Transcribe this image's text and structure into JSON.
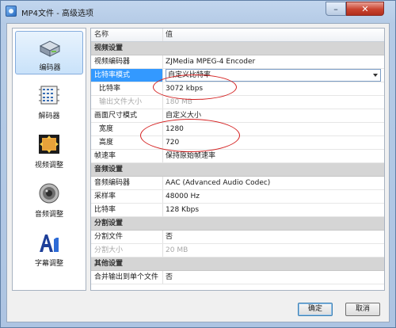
{
  "window": {
    "title": "MP4文件 - 高级选项",
    "minimize_glyph": "–",
    "close_glyph": "✕"
  },
  "sidebar": {
    "items": [
      {
        "label": "编码器",
        "icon": "encoder-icon",
        "active": true
      },
      {
        "label": "解码器",
        "icon": "decoder-icon",
        "active": false
      },
      {
        "label": "视频调整",
        "icon": "video-adjust-icon",
        "active": false
      },
      {
        "label": "音频调整",
        "icon": "audio-adjust-icon",
        "active": false
      },
      {
        "label": "字幕调整",
        "icon": "subtitle-adjust-icon",
        "active": false
      }
    ]
  },
  "grid": {
    "header": {
      "name": "名称",
      "value": "值"
    },
    "categories": {
      "video": "视频设置",
      "audio": "音频设置",
      "split": "分割设置",
      "other": "其他设置"
    },
    "video_rows": {
      "encoder": {
        "name": "视频编码器",
        "value": "ZJMedia MPEG-4 Encoder"
      },
      "bitrate_mode": {
        "name": "比特率模式",
        "value": "自定义比特率"
      },
      "bitrate": {
        "name": "比特率",
        "value": "3072 kbps"
      },
      "output_size": {
        "name": "输出文件大小",
        "value": "180 MB"
      },
      "frame_mode": {
        "name": "画面尺寸模式",
        "value": "自定义大小"
      },
      "width": {
        "name": "宽度",
        "value": "1280"
      },
      "height": {
        "name": "高度",
        "value": "720"
      },
      "framerate": {
        "name": "帧速率",
        "value": "保持原始帧速率"
      }
    },
    "audio_rows": {
      "encoder": {
        "name": "音频编码器",
        "value": "AAC (Advanced Audio Codec)"
      },
      "samplerate": {
        "name": "采样率",
        "value": "48000 Hz"
      },
      "bitrate": {
        "name": "比特率",
        "value": "128 Kbps"
      }
    },
    "split_rows": {
      "split_file": {
        "name": "分割文件",
        "value": "否"
      },
      "split_size": {
        "name": "分割大小",
        "value": "20 MB"
      }
    },
    "other_rows": {
      "merge_output": {
        "name": "合并输出到单个文件",
        "value": "否"
      }
    }
  },
  "footer": {
    "ok_label": "确定",
    "cancel_label": "取消"
  },
  "colors": {
    "selection": "#3399ff",
    "annotation": "#d42020",
    "title_bar": "#b5cbe6"
  }
}
